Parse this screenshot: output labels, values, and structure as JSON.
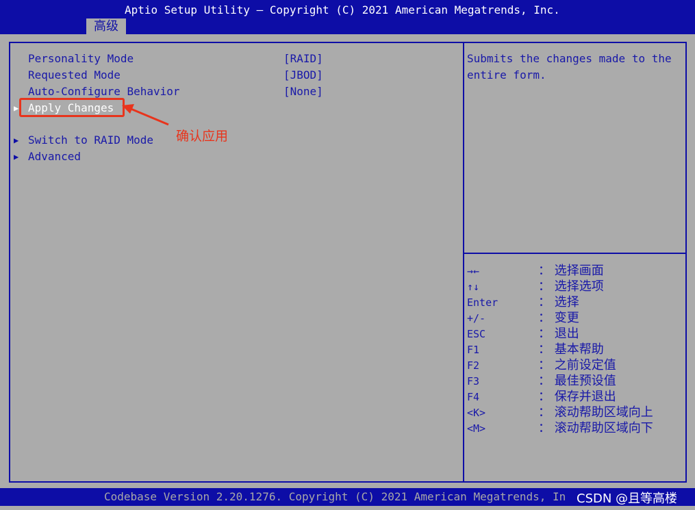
{
  "header": {
    "title": "Aptio Setup Utility – Copyright (C) 2021 American Megatrends, Inc.",
    "active_tab": "高级"
  },
  "menu": {
    "items": [
      {
        "label": "Personality Mode",
        "value": "[RAID]"
      },
      {
        "label": "Requested Mode",
        "value": "[JBOD]"
      },
      {
        "label": "Auto-Configure Behavior",
        "value": "[None]"
      },
      {
        "label": "Apply Changes",
        "value": ""
      },
      {
        "label": "Switch to RAID Mode",
        "value": ""
      },
      {
        "label": "Advanced",
        "value": ""
      }
    ],
    "arrow_glyph": "▶"
  },
  "annotation": {
    "text": "确认应用",
    "color": "#e8341c"
  },
  "help": {
    "text": "Submits the changes made to the entire form."
  },
  "keys": [
    {
      "key": "→←",
      "desc": "： 选择画面"
    },
    {
      "key": "↑↓",
      "desc": "： 选择选项"
    },
    {
      "key": "Enter",
      "desc": "： 选择"
    },
    {
      "key": "+/-",
      "desc": "： 变更"
    },
    {
      "key": "ESC",
      "desc": "： 退出"
    },
    {
      "key": "F1",
      "desc": "： 基本帮助"
    },
    {
      "key": "F2",
      "desc": "： 之前设定值"
    },
    {
      "key": "F3",
      "desc": "： 最佳预设值"
    },
    {
      "key": "F4",
      "desc": "： 保存并退出"
    },
    {
      "key": "<K>",
      "desc": "： 滚动帮助区域向上"
    },
    {
      "key": "<M>",
      "desc": "： 滚动帮助区域向下"
    }
  ],
  "footer": {
    "text": "Codebase Version 2.20.1276. Copyright (C) 2021 American Megatrends, In",
    "watermark": "CSDN @且等高楼"
  },
  "colors": {
    "bios_blue": "#0d0da6",
    "background_gray": "#ababab",
    "selected_text": "#ffffff"
  }
}
